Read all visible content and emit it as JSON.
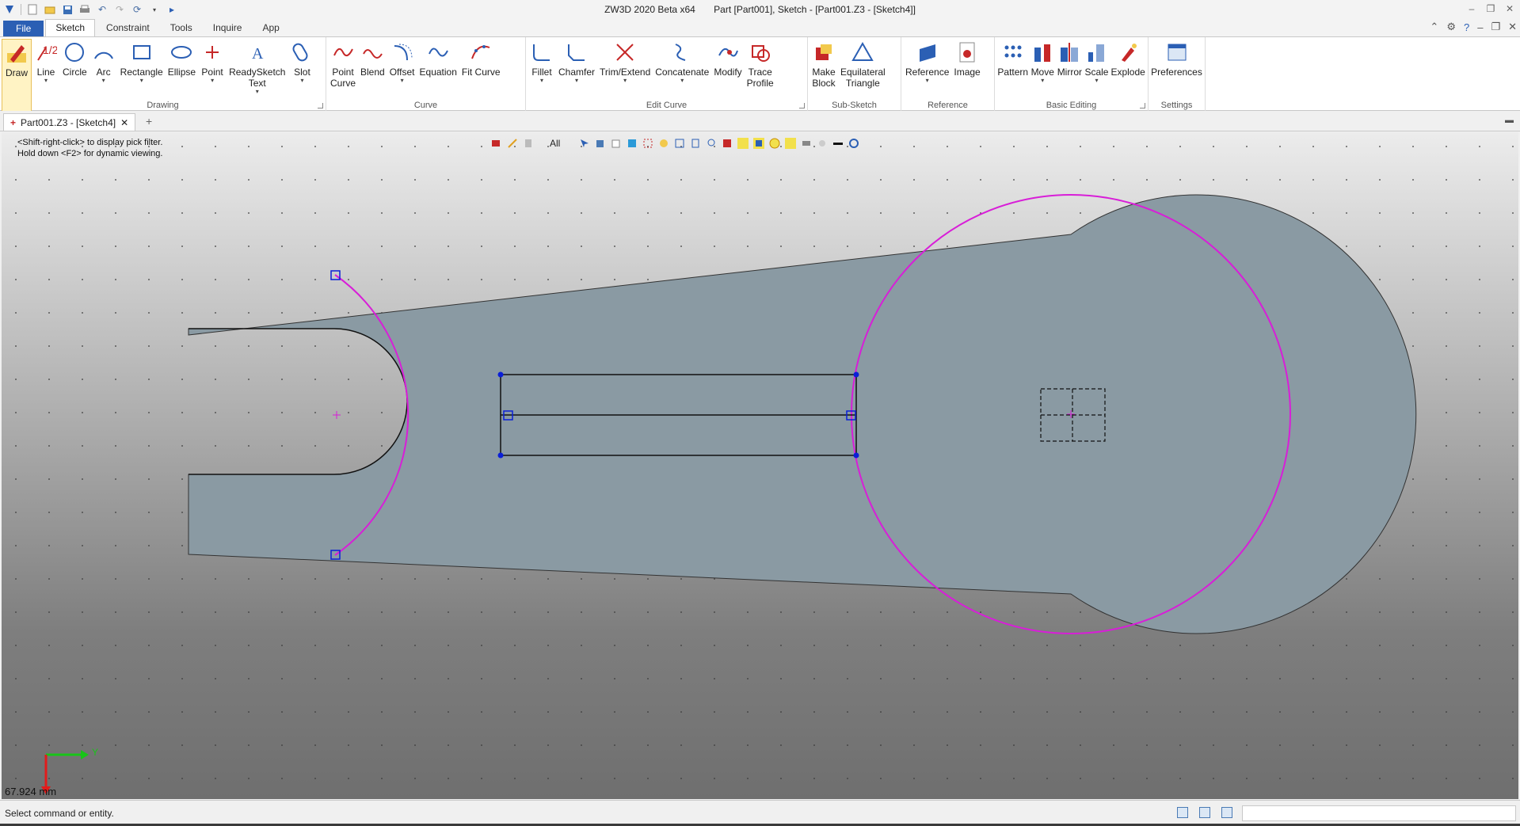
{
  "app": {
    "title": "ZW3D 2020 Beta x64",
    "document_title": "Part [Part001],  Sketch - [Part001.Z3 - [Sketch4]]"
  },
  "ribbon_tabs": [
    {
      "label": "File"
    },
    {
      "label": "Sketch"
    },
    {
      "label": "Constraint"
    },
    {
      "label": "Tools"
    },
    {
      "label": "Inquire"
    },
    {
      "label": "App"
    }
  ],
  "ribbon": {
    "drawing": {
      "label": "Drawing",
      "buttons": [
        "Draw",
        "Line",
        "Circle",
        "Arc",
        "Rectangle",
        "Ellipse",
        "Point",
        "ReadySketch\nText",
        "Slot"
      ]
    },
    "curve": {
      "label": "Curve",
      "buttons": [
        "Point\nCurve",
        "Blend",
        "Offset",
        "Equation",
        "Fit Curve"
      ]
    },
    "edit_curve": {
      "label": "Edit Curve",
      "buttons": [
        "Fillet",
        "Chamfer",
        "Trim/Extend",
        "Concatenate",
        "Modify",
        "Trace\nProfile"
      ]
    },
    "sub_sketch": {
      "label": "Sub-Sketch",
      "buttons": [
        "Make\nBlock",
        "Equilateral\nTriangle"
      ]
    },
    "reference": {
      "label": "Reference",
      "buttons": [
        "Reference",
        "Image"
      ]
    },
    "basic_editing": {
      "label": "Basic Editing",
      "buttons": [
        "Pattern",
        "Move",
        "Mirror",
        "Scale",
        "Explode"
      ]
    },
    "settings": {
      "label": "Settings",
      "buttons": [
        "Preferences"
      ]
    }
  },
  "doc_tab": {
    "label": "Part001.Z3 - [Sketch4]"
  },
  "viewport": {
    "hint_line1": "<Shift-right-click> to display pick filter.",
    "hint_line2": "Hold down <F2> for dynamic viewing.",
    "filter_label": "All",
    "scale_readout": "67.924 mm",
    "axis_y_label": "Y"
  },
  "status": {
    "text": "Select command or entity."
  },
  "colors": {
    "accent_file_tab": "#2b5fb4",
    "sketch_magenta": "#d81ed8",
    "part_fill": "#8a9aa3",
    "handle_blue": "#0a1fd8"
  }
}
